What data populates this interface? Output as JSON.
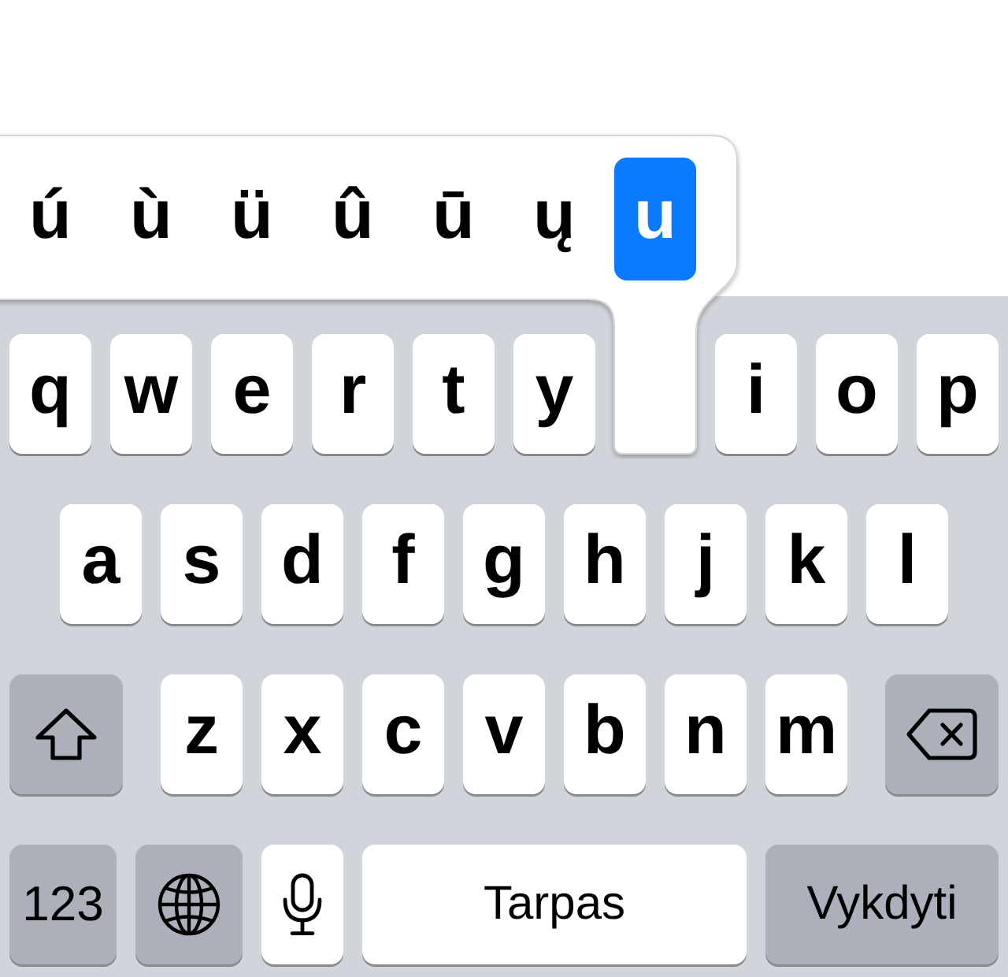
{
  "accent_popup": {
    "options": [
      {
        "label": "ú",
        "selected": false
      },
      {
        "label": "ù",
        "selected": false
      },
      {
        "label": "ü",
        "selected": false
      },
      {
        "label": "û",
        "selected": false
      },
      {
        "label": "ū",
        "selected": false
      },
      {
        "label": "ų",
        "selected": false
      },
      {
        "label": "u",
        "selected": true
      }
    ]
  },
  "keyboard": {
    "rows": [
      {
        "keys": [
          {
            "kind": "letter",
            "label": "q"
          },
          {
            "kind": "letter",
            "label": "w"
          },
          {
            "kind": "letter",
            "label": "e"
          },
          {
            "kind": "letter",
            "label": "r"
          },
          {
            "kind": "letter",
            "label": "t"
          },
          {
            "kind": "letter",
            "label": "y"
          },
          {
            "kind": "pressed"
          },
          {
            "kind": "letter",
            "label": "i"
          },
          {
            "kind": "letter",
            "label": "o"
          },
          {
            "kind": "letter",
            "label": "p"
          }
        ]
      },
      {
        "keys": [
          {
            "kind": "letter",
            "label": "a"
          },
          {
            "kind": "letter",
            "label": "s"
          },
          {
            "kind": "letter",
            "label": "d"
          },
          {
            "kind": "letter",
            "label": "f"
          },
          {
            "kind": "letter",
            "label": "g"
          },
          {
            "kind": "letter",
            "label": "h"
          },
          {
            "kind": "letter",
            "label": "j"
          },
          {
            "kind": "letter",
            "label": "k"
          },
          {
            "kind": "letter",
            "label": "l"
          }
        ]
      },
      {
        "keys": [
          {
            "kind": "shift"
          },
          {
            "kind": "letter",
            "label": "z"
          },
          {
            "kind": "letter",
            "label": "x"
          },
          {
            "kind": "letter",
            "label": "c"
          },
          {
            "kind": "letter",
            "label": "v"
          },
          {
            "kind": "letter",
            "label": "b"
          },
          {
            "kind": "letter",
            "label": "n"
          },
          {
            "kind": "letter",
            "label": "m"
          },
          {
            "kind": "delete"
          }
        ]
      },
      {
        "keys": [
          {
            "kind": "mode",
            "label": "123"
          },
          {
            "kind": "globe"
          },
          {
            "kind": "dictation"
          },
          {
            "kind": "space",
            "label": "Tarpas"
          },
          {
            "kind": "return",
            "label": "Vykdyti"
          }
        ]
      }
    ]
  }
}
